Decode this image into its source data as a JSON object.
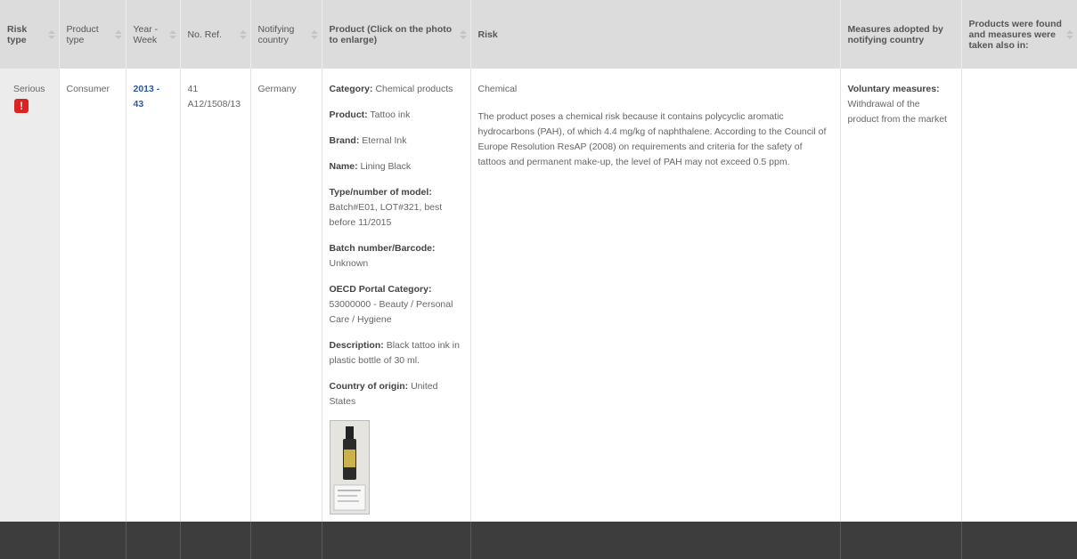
{
  "headers": {
    "risk_type": "Risk type",
    "product_type": "Product type",
    "year_week": "Year - Week",
    "no_ref": "No. Ref.",
    "notifying_country": "Notifying country",
    "product": "Product (Click on the photo to enlarge)",
    "risk": "Risk",
    "measures": "Measures adopted by notifying country",
    "also_in": "Products were found and measures were taken also in:"
  },
  "row": {
    "risk_type": "Serious",
    "risk_icon": "warning-exclamation-icon",
    "product_type": "Consumer",
    "year_week": "2013 - 43",
    "ref_number": "41",
    "ref_code": "A12/1508/13",
    "notifying_country": "Germany",
    "product_fields": [
      {
        "label": "Category:",
        "value": "Chemical products"
      },
      {
        "label": "Product:",
        "value": "Tattoo ink"
      },
      {
        "label": "Brand:",
        "value": "Eternal Ink"
      },
      {
        "label": "Name:",
        "value": "Lining Black"
      },
      {
        "label": "Type/number of model:",
        "value": "Batch#E01, LOT#321, best before 11/2015"
      },
      {
        "label": "Batch number/Barcode:",
        "value": "Unknown"
      },
      {
        "label": "OECD Portal Category:",
        "value": "53000000 - Beauty / Personal Care / Hygiene"
      },
      {
        "label": "Description:",
        "value": "Black tattoo ink in plastic bottle of 30 ml."
      },
      {
        "label": "Country of origin:",
        "value": "United States"
      }
    ],
    "risk_category": "Chemical",
    "risk_text": "The product poses a chemical risk because it contains polycyclic aromatic hydrocarbons (PAH), of which 4.4 mg/kg of naphthalene. According to the Council of Europe Resolution ResAP (2008) on requirements and criteria for the safety of tattoos and permanent make-up, the level of PAH may not exceed 0.5 ppm.",
    "measures_label": "Voluntary measures:",
    "measures_text": "Withdrawal of the product from the market",
    "also_in": ""
  },
  "colors": {
    "header_bg": "#dcdcdc",
    "first_col_bg": "#ececec",
    "link": "#2a5aa0",
    "risk_icon": "#dd2222",
    "footer_bar": "#3d3d3d"
  }
}
